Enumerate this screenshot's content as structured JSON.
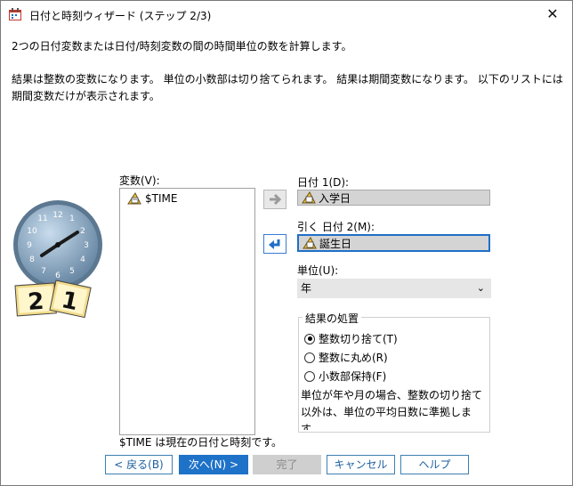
{
  "window": {
    "title": "日付と時刻ウィザード (ステップ 2/3)"
  },
  "desc": {
    "line1": "2つの日付変数または日付/時刻変数の間の時間単位の数を計算します。",
    "line2": "結果は整数の変数になります。 単位の小数部は切り捨てられます。 結果は期間変数になります。 以下のリストには期間変数だけが表示されます。"
  },
  "variables": {
    "label": "変数(V):",
    "items": [
      "$TIME"
    ]
  },
  "date1": {
    "label": "日付 1(D):",
    "value": "入学日"
  },
  "date2": {
    "label": "引く 日付 2(M):",
    "value": "誕生日"
  },
  "unit": {
    "label": "単位(U):",
    "selected": "年"
  },
  "result": {
    "legend": "結果の処置",
    "options": [
      "整数切り捨て(T)",
      "整数に丸め(R)",
      "小数部保持(F)"
    ],
    "selected_index": 0,
    "note": "単位が年や月の場合、整数の切り捨て以外は、単位の平均日数に準拠します。"
  },
  "footer_note": "$TIME は現在の日付と時刻です。",
  "buttons": {
    "back": "< 戻る(B)",
    "next": "次へ(N) >",
    "finish": "完了",
    "cancel": "キャンセル",
    "help": "ヘルプ"
  },
  "clock": {
    "calendar_left": "2",
    "calendar_right": "1"
  }
}
